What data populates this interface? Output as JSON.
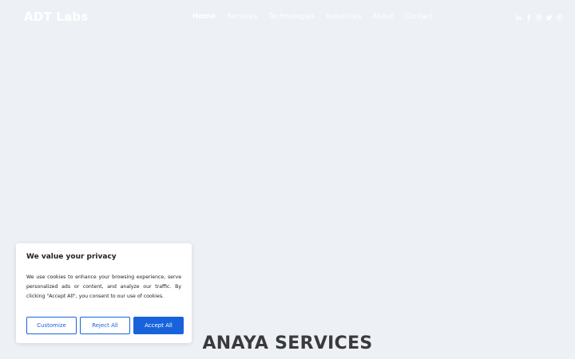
{
  "header": {
    "logo": "ADT Labs",
    "nav": [
      "Home",
      "Services",
      "Technologies",
      "Industries",
      "About",
      "Contact"
    ],
    "social_icons": [
      "linkedin-icon",
      "facebook-icon",
      "instagram-icon",
      "twitter-icon",
      "skype-icon"
    ]
  },
  "cookie": {
    "title": "We value your privacy",
    "text": "We use cookies to enhance your browsing experience, serve personalized ads or content, and analyze our traffic. By clicking \"Accept All\", you consent to our use of cookies.",
    "customize": "Customize",
    "reject": "Reject All",
    "accept": "Accept All"
  },
  "section": {
    "title": "ANAYA SERVICES"
  },
  "colors": {
    "accent": "#1863dc",
    "background": "#edf1f5"
  }
}
